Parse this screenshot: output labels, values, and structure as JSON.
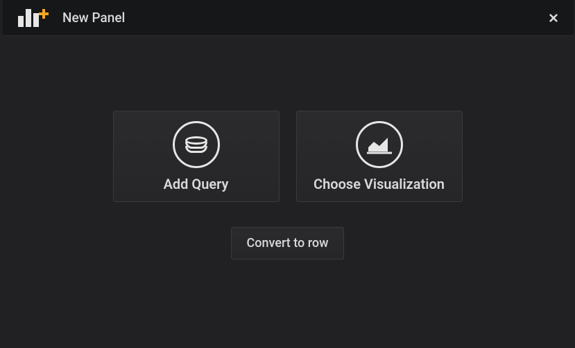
{
  "header": {
    "title": "New Panel"
  },
  "actions": {
    "add_query_label": "Add Query",
    "choose_visualization_label": "Choose Visualization",
    "convert_to_row_label": "Convert to row"
  }
}
